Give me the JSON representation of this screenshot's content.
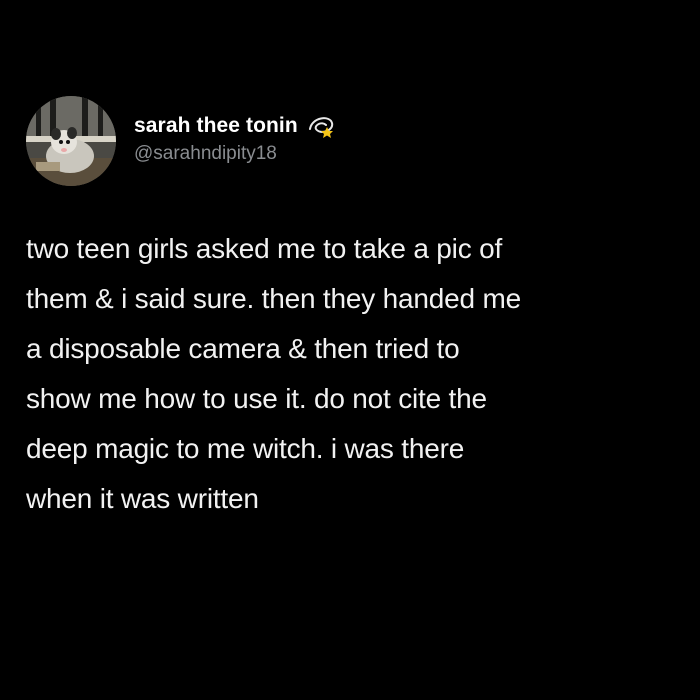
{
  "tweet": {
    "author": {
      "display_name": "sarah thee tonin",
      "name_emoji": "dizzy-icon",
      "handle": "@sarahndipity18",
      "avatar": "opossum-avatar"
    },
    "text": "two teen girls asked me to take a pic of\nthem & i said sure. then they handed me\na disposable camera & then tried to\nshow me how to use it. do not cite the\ndeep magic to me witch. i was there\nwhen it was written"
  },
  "colors": {
    "background": "#000000",
    "text": "#f2f2f2",
    "handle": "#8a8d91"
  }
}
